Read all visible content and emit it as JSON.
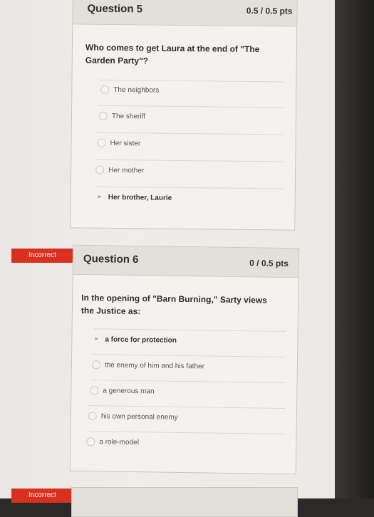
{
  "q5": {
    "title": "Question 5",
    "points": "0.5 / 0.5 pts",
    "text": "Who comes to get Laura at the end of \"The Garden Party\"?",
    "answers": [
      {
        "label": "The neighbors"
      },
      {
        "label": "The sheriff"
      },
      {
        "label": "Her sister"
      },
      {
        "label": "Her mother"
      },
      {
        "label": "Her brother, Laurie"
      }
    ]
  },
  "q6": {
    "badge": "Incorrect",
    "title": "Question 6",
    "points": "0 / 0.5 pts",
    "text": "In the opening of \"Barn Burning,\" Sarty views the Justice as:",
    "answers": [
      {
        "label": "a force for protection"
      },
      {
        "label": "the enemy of him and his father"
      },
      {
        "label": "a generous man"
      },
      {
        "label": "his own personal enemy"
      },
      {
        "label": "a role-model"
      }
    ]
  },
  "q7": {
    "badge": "Incorrect"
  },
  "colors": {
    "incorrect_badge": "#d9301f"
  }
}
